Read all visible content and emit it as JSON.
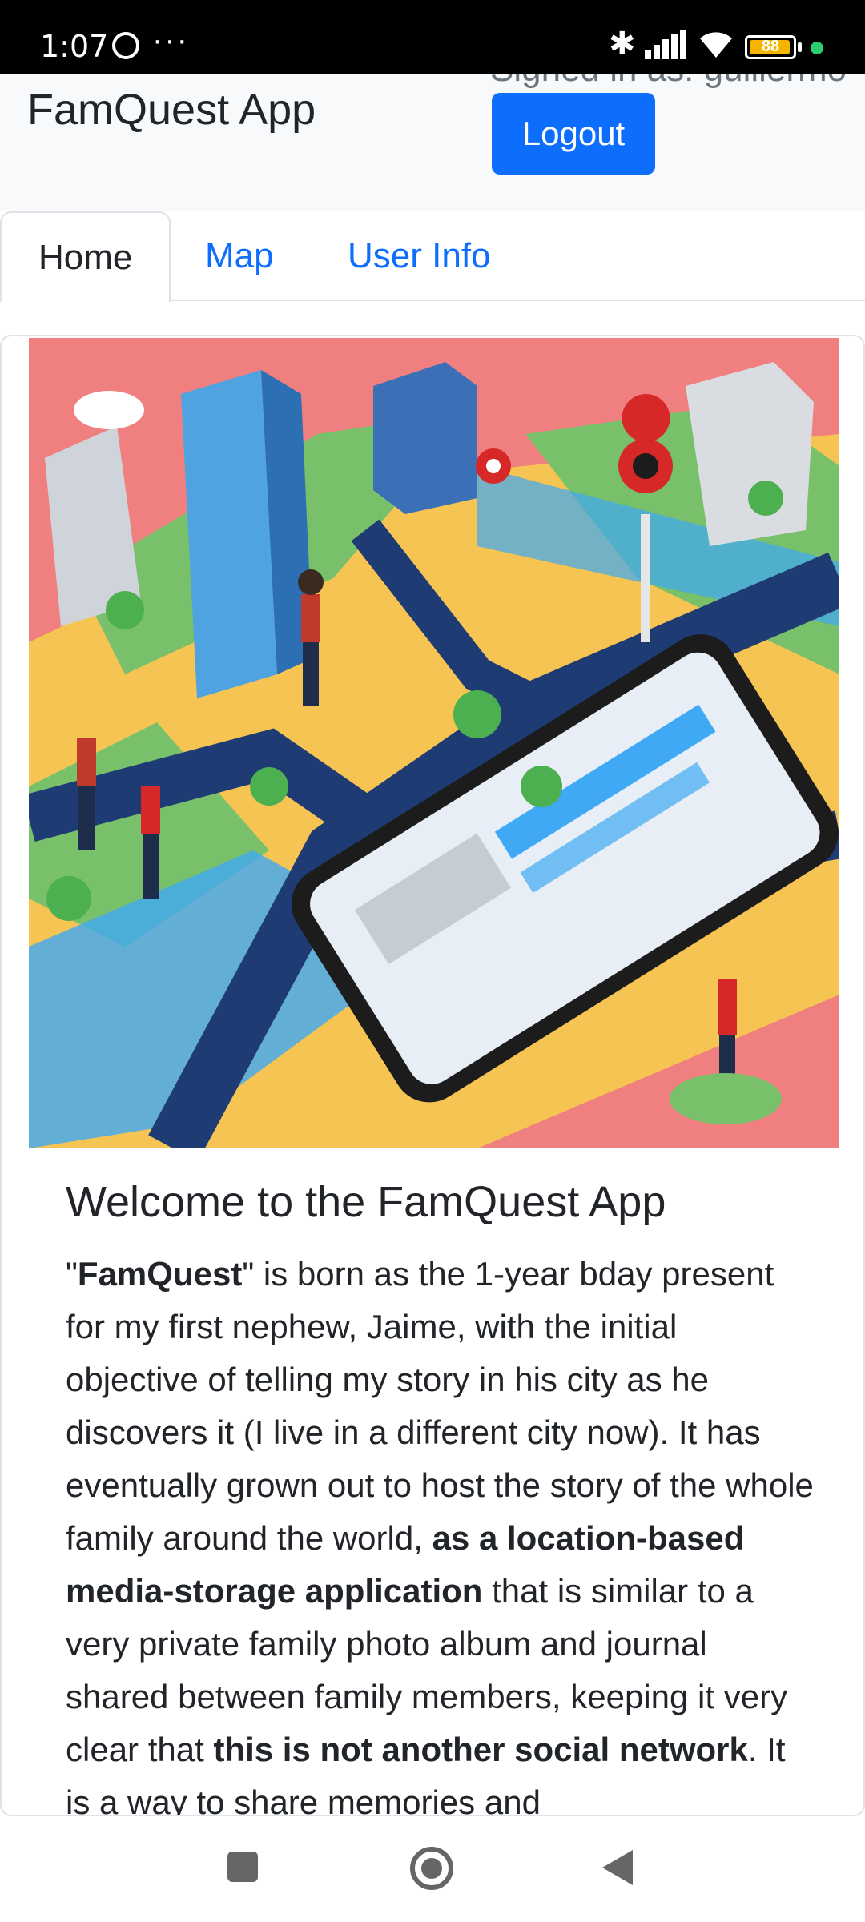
{
  "status_bar": {
    "time": "1:07",
    "overflow_dots": "···",
    "battery_level": "88",
    "bluetooth_glyph": "✱",
    "icons": [
      "whatsapp-icon",
      "bluetooth-icon",
      "signal-icon",
      "wifi-icon",
      "battery-icon",
      "status-dot-icon"
    ]
  },
  "header": {
    "brand": "FamQuest App",
    "signed_in_text": "Signed in as: guillermo",
    "logout_label": "Logout"
  },
  "tabs": [
    {
      "label": "Home",
      "active": true
    },
    {
      "label": "Map",
      "active": false
    },
    {
      "label": "User Info",
      "active": false
    }
  ],
  "home": {
    "title": "Welcome to the FamQuest App",
    "para": [
      {
        "text": "\"",
        "bold": false
      },
      {
        "text": "FamQuest",
        "bold": true
      },
      {
        "text": "\" is born as the 1-year bday present for my first nephew, Jaime, with the initial objective of telling my story in his city as he discovers it (I live in a different city now). It has eventually grown out to host the story of the whole family around the world, ",
        "bold": false
      },
      {
        "text": "as a location-based media-storage application",
        "bold": true
      },
      {
        "text": " that is similar to a very private family photo album and journal shared between family members, keeping it very clear that ",
        "bold": false
      },
      {
        "text": "this is not another social network",
        "bold": true
      },
      {
        "text": ". It is a way to share memories and",
        "bold": false
      }
    ]
  },
  "colors": {
    "primary": "#0d6efd",
    "header_bg": "#f8f9fa",
    "hero_bg": "#f08080"
  },
  "nav": {
    "icons": [
      "recents-icon",
      "home-icon",
      "back-icon"
    ]
  }
}
